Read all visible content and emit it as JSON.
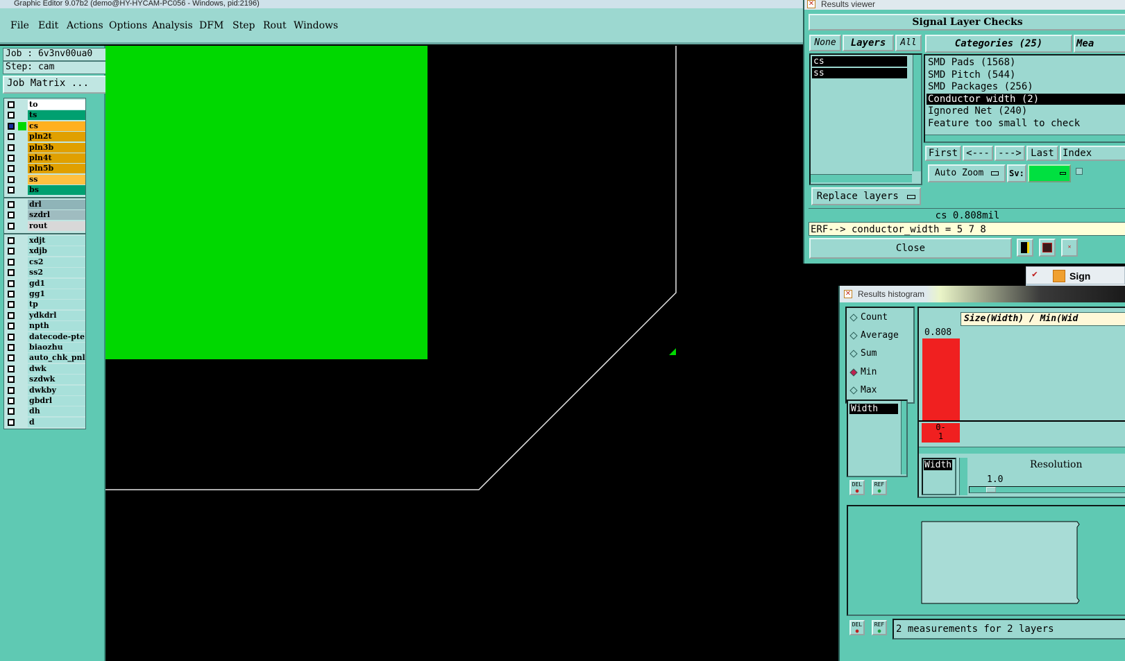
{
  "window": {
    "title": "Graphic Editor 9.07b2 (demo@HY-HYCAM-PC056 - Windows, pid:2196)"
  },
  "menu": [
    "File",
    "Edit",
    "Actions",
    "Options",
    "Analysis",
    "DFM",
    "Step",
    "Rout",
    "Windows"
  ],
  "job": {
    "job_label": "Job : 6v3nv00ua0",
    "step_label": "Step: cam",
    "matrix_button": "Job Matrix ..."
  },
  "layers": {
    "board": [
      {
        "name": "to",
        "color": "#ffffff"
      },
      {
        "name": "ts",
        "color": "#00a070"
      },
      {
        "name": "cs",
        "color": "#ffb020",
        "active": true
      },
      {
        "name": "pln2t",
        "color": "#e0a000"
      },
      {
        "name": "pln3b",
        "color": "#e0a000"
      },
      {
        "name": "pln4t",
        "color": "#e0a000"
      },
      {
        "name": "pln5b",
        "color": "#e0a000"
      },
      {
        "name": "ss",
        "color": "#ffc040"
      },
      {
        "name": "bs",
        "color": "#00a070"
      }
    ],
    "drill": [
      {
        "name": "drl",
        "color": "#8fb4b8"
      },
      {
        "name": "szdrl",
        "color": "#9fbcc0"
      },
      {
        "name": "rout",
        "color": "#d8d8d8"
      }
    ],
    "misc": [
      {
        "name": "xdjt"
      },
      {
        "name": "xdjb"
      },
      {
        "name": "cs2"
      },
      {
        "name": "ss2"
      },
      {
        "name": "gd1"
      },
      {
        "name": "gg1"
      },
      {
        "name": "tp"
      },
      {
        "name": "ydkdrl"
      },
      {
        "name": "npth"
      },
      {
        "name": "datecode-pte"
      },
      {
        "name": "biaozhu"
      },
      {
        "name": "auto_chk_pnl"
      },
      {
        "name": "dwk"
      },
      {
        "name": "szdwk"
      },
      {
        "name": "dwkby"
      },
      {
        "name": "gbdrl"
      },
      {
        "name": "dh"
      },
      {
        "name": "d"
      }
    ]
  },
  "results_viewer": {
    "title": "Results viewer",
    "header": "Signal Layer Checks",
    "none_btn": "None",
    "layers_btn": "Layers",
    "all_btn": "All",
    "layer_list": [
      "cs",
      "ss"
    ],
    "categories_btn": "Categories (25)",
    "measure_btn": "Mea",
    "categories": [
      "SMD Pads (1568)",
      "SMD Pitch (544)",
      "SMD Packages (256)",
      "Conductor width (2)",
      "Ignored Net (240)",
      "Feature too small to check"
    ],
    "selected_category": "Conductor width (2)",
    "first_btn": "First",
    "prev_btn": "<---",
    "next_btn": "--->",
    "last_btn": "Last",
    "index_btn": "Index",
    "autozoom_btn": "Auto Zoom",
    "sv_label": "Sv:",
    "replace_btn": "Replace layers",
    "measure_line": "cs 0.808mil",
    "erf_line": "ERF--> conductor_width = 5 7 8",
    "close_btn": "Close"
  },
  "side_item": {
    "label": "Sign"
  },
  "histogram": {
    "title": "Results histogram",
    "modes": [
      "Count",
      "Average",
      "Sum",
      "Min",
      "Max"
    ],
    "selected_mode": "Min",
    "axis_title": "Size(Width) / Min(Wid",
    "bar_value": "0.808",
    "bin_label": "0-\n1",
    "attr_list": [
      "Width"
    ],
    "attr2": "Width",
    "resolution_label": "Resolution",
    "resolution_value": "1.0",
    "del_label": "DEL",
    "ref_label": "REF",
    "status": "2 measurements for 2 layers"
  },
  "colors": {
    "teal": "#5fc9b3",
    "light_teal": "#9cd8d0",
    "green_fill": "#00d800",
    "bar_red": "#f02020"
  }
}
